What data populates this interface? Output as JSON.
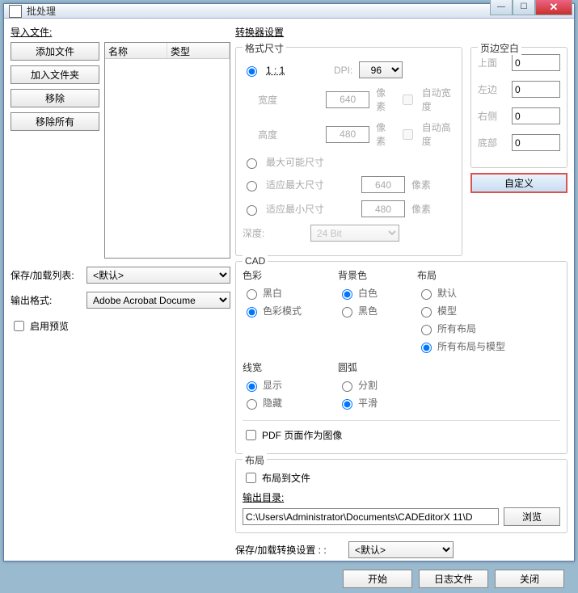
{
  "title": "批处理",
  "left": {
    "import_label": "导入文件:",
    "add_file": "添加文件",
    "add_folder": "加入文件夹",
    "remove": "移除",
    "remove_all": "移除所有",
    "col_name": "名称",
    "col_type": "类型",
    "save_list_label": "保存/加载列表:",
    "save_list_value": "<默认>",
    "output_fmt_label": "输出格式:",
    "output_fmt_value": "Adobe Acrobat Docume",
    "enable_preview": "启用预览"
  },
  "conv": {
    "header": "转换器设置",
    "format_header": "格式尺寸",
    "ratio_label": "1 : 1",
    "dpi_label": "DPI:",
    "dpi_value": "96",
    "width_label": "宽度",
    "width_value": "640",
    "height_label": "高度",
    "height_value": "480",
    "px": "像素",
    "auto_w": "自动宽度",
    "auto_h": "自动高度",
    "max_possible": "最大可能尺寸",
    "fit_max": "适应最大尺寸",
    "fit_max_v": "640",
    "fit_min": "适应最小尺寸",
    "fit_min_v": "480",
    "depth_label": "深度:",
    "depth_value": "24 Bit",
    "margin_header": "页边空白",
    "m_top": "上面",
    "m_top_v": "0",
    "m_left": "左边",
    "m_left_v": "0",
    "m_right": "右侧",
    "m_right_v": "0",
    "m_bottom": "底部",
    "m_bottom_v": "0",
    "custom": "自定义",
    "cad_header": "CAD",
    "color_header": "色彩",
    "color_bw": "黑白",
    "color_mode": "色彩模式",
    "bg_header": "背景色",
    "bg_white": "白色",
    "bg_black": "黑色",
    "layout_header": "布局",
    "layout_default": "默认",
    "layout_model": "模型",
    "layout_all": "所有布局",
    "layout_all_model": "所有布局与模型",
    "lw_header": "线宽",
    "lw_show": "显示",
    "lw_hide": "隐藏",
    "arc_header": "圆弧",
    "arc_split": "分割",
    "arc_smooth": "平滑",
    "pdf_as_image": "PDF 页面作为图像",
    "out_layout_header": "布局",
    "layout_to_file": "布局到文件",
    "out_dir_label": "输出目录:",
    "out_dir_value": "C:\\Users\\Administrator\\Documents\\CADEditorX 11\\D",
    "browse": "浏览",
    "save_conv_label": "保存/加载转换设置 : :",
    "save_conv_value": "<默认>"
  },
  "footer": {
    "start": "开始",
    "log": "日志文件",
    "close": "关闭"
  }
}
